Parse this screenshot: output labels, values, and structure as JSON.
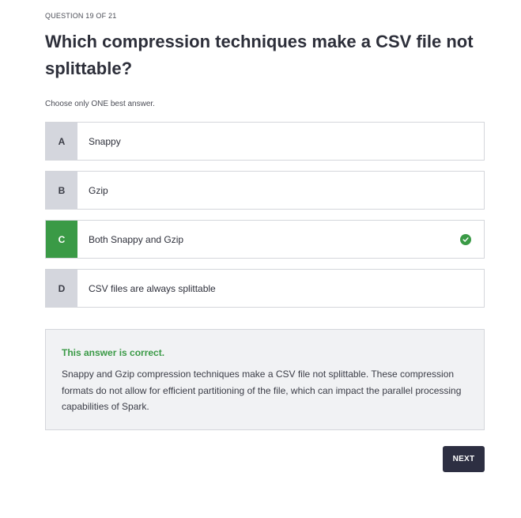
{
  "quiz": {
    "counter": "QUESTION 19 OF 21",
    "question": "Which compression techniques make a CSV file not splittable?",
    "instruction": "Choose only ONE best answer.",
    "options": [
      {
        "letter": "A",
        "text": "Snappy",
        "state": "default"
      },
      {
        "letter": "B",
        "text": "Gzip",
        "state": "default"
      },
      {
        "letter": "C",
        "text": "Both Snappy and Gzip",
        "state": "correct-selected"
      },
      {
        "letter": "D",
        "text": "CSV files are always splittable",
        "state": "default"
      }
    ],
    "feedback": {
      "verdict": "This answer is correct.",
      "explanation": "Snappy and Gzip compression techniques make a CSV file not splittable. These compression formats do not allow for efficient partitioning of the file, which can impact the parallel processing capabilities of Spark."
    },
    "next_label": "NEXT"
  },
  "colors": {
    "correct": "#3a9a46",
    "letter_bg": "#d4d6dd",
    "next_bg": "#2d2f42",
    "feedback_bg": "#f1f2f4"
  },
  "icons": {
    "correct_indicator": "check-circle-icon"
  }
}
